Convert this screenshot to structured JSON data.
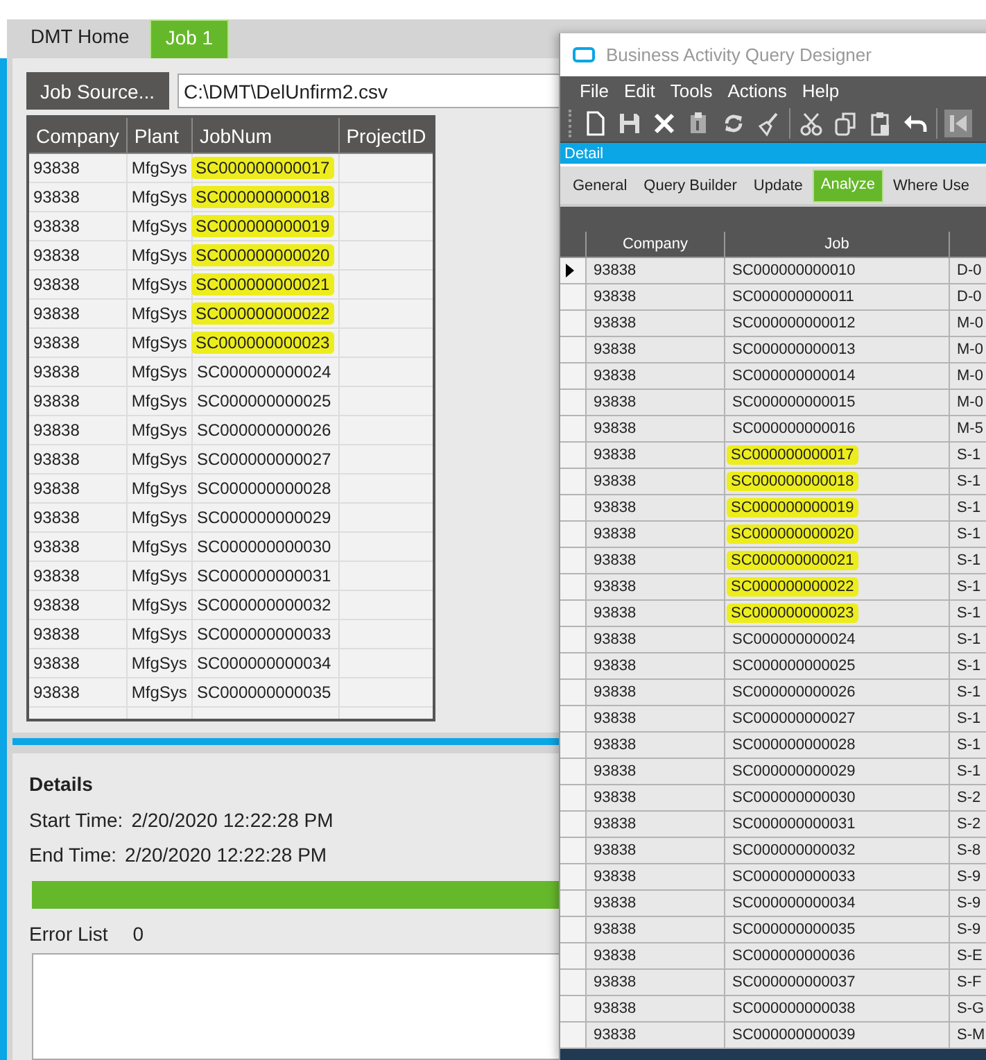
{
  "app": {
    "tabs": [
      {
        "label": "DMT Home",
        "selected": false
      },
      {
        "label": "Job 1",
        "selected": true
      }
    ],
    "job_source_button": "Job Source...",
    "job_source_path": "C:\\DMT\\DelUnfirm2.csv",
    "table": {
      "columns": [
        "Company",
        "Plant",
        "JobNum",
        "ProjectID"
      ],
      "rows": [
        {
          "company": "93838",
          "plant": "MfgSys",
          "jobnum": "SC000000000017",
          "highlighted": true
        },
        {
          "company": "93838",
          "plant": "MfgSys",
          "jobnum": "SC000000000018",
          "highlighted": true
        },
        {
          "company": "93838",
          "plant": "MfgSys",
          "jobnum": "SC000000000019",
          "highlighted": true
        },
        {
          "company": "93838",
          "plant": "MfgSys",
          "jobnum": "SC000000000020",
          "highlighted": true
        },
        {
          "company": "93838",
          "plant": "MfgSys",
          "jobnum": "SC000000000021",
          "highlighted": true
        },
        {
          "company": "93838",
          "plant": "MfgSys",
          "jobnum": "SC000000000022",
          "highlighted": true
        },
        {
          "company": "93838",
          "plant": "MfgSys",
          "jobnum": "SC000000000023",
          "highlighted": true
        },
        {
          "company": "93838",
          "plant": "MfgSys",
          "jobnum": "SC000000000024",
          "highlighted": false
        },
        {
          "company": "93838",
          "plant": "MfgSys",
          "jobnum": "SC000000000025",
          "highlighted": false
        },
        {
          "company": "93838",
          "plant": "MfgSys",
          "jobnum": "SC000000000026",
          "highlighted": false
        },
        {
          "company": "93838",
          "plant": "MfgSys",
          "jobnum": "SC000000000027",
          "highlighted": false
        },
        {
          "company": "93838",
          "plant": "MfgSys",
          "jobnum": "SC000000000028",
          "highlighted": false
        },
        {
          "company": "93838",
          "plant": "MfgSys",
          "jobnum": "SC000000000029",
          "highlighted": false
        },
        {
          "company": "93838",
          "plant": "MfgSys",
          "jobnum": "SC000000000030",
          "highlighted": false
        },
        {
          "company": "93838",
          "plant": "MfgSys",
          "jobnum": "SC000000000031",
          "highlighted": false
        },
        {
          "company": "93838",
          "plant": "MfgSys",
          "jobnum": "SC000000000032",
          "highlighted": false
        },
        {
          "company": "93838",
          "plant": "MfgSys",
          "jobnum": "SC000000000033",
          "highlighted": false
        },
        {
          "company": "93838",
          "plant": "MfgSys",
          "jobnum": "SC000000000034",
          "highlighted": false
        },
        {
          "company": "93838",
          "plant": "MfgSys",
          "jobnum": "SC000000000035",
          "highlighted": false
        }
      ]
    },
    "details": {
      "title": "Details",
      "start_time_label": "Start Time:",
      "start_time": "2/20/2020 12:22:28 PM",
      "end_time_label": "End Time:",
      "end_time": "2/20/2020 12:22:28 PM",
      "progress": {
        "level": 1
      },
      "error_list_label": "Error List",
      "error_count": "0"
    }
  },
  "query_designer": {
    "title": "Business Activity Query Designer",
    "menu": [
      "File",
      "Edit",
      "Tools",
      "Actions",
      "Help"
    ],
    "panel_title": "Detail",
    "tabs": [
      {
        "label": "General",
        "selected": false
      },
      {
        "label": "Query Builder",
        "selected": false
      },
      {
        "label": "Update",
        "selected": false
      },
      {
        "label": "Analyze",
        "selected": true
      },
      {
        "label": "Where Use",
        "selected": false
      }
    ],
    "grid": {
      "columns": [
        "Company",
        "Job"
      ],
      "rows": [
        {
          "company": "93838",
          "job": "SC000000000010",
          "column_3": "D-0",
          "current": true,
          "highlighted": false
        },
        {
          "company": "93838",
          "job": "SC000000000011",
          "column_3": "D-0",
          "current": false,
          "highlighted": false
        },
        {
          "company": "93838",
          "job": "SC000000000012",
          "column_3": "M-0",
          "current": false,
          "highlighted": false
        },
        {
          "company": "93838",
          "job": "SC000000000013",
          "column_3": "M-0",
          "current": false,
          "highlighted": false
        },
        {
          "company": "93838",
          "job": "SC000000000014",
          "column_3": "M-0",
          "current": false,
          "highlighted": false
        },
        {
          "company": "93838",
          "job": "SC000000000015",
          "column_3": "M-0",
          "current": false,
          "highlighted": false
        },
        {
          "company": "93838",
          "job": "SC000000000016",
          "column_3": "M-5",
          "current": false,
          "highlighted": false
        },
        {
          "company": "93838",
          "job": "SC000000000017",
          "column_3": "S-1",
          "current": false,
          "highlighted": true
        },
        {
          "company": "93838",
          "job": "SC000000000018",
          "column_3": "S-1",
          "current": false,
          "highlighted": true
        },
        {
          "company": "93838",
          "job": "SC000000000019",
          "column_3": "S-1",
          "current": false,
          "highlighted": true
        },
        {
          "company": "93838",
          "job": "SC000000000020",
          "column_3": "S-1",
          "current": false,
          "highlighted": true
        },
        {
          "company": "93838",
          "job": "SC000000000021",
          "column_3": "S-1",
          "current": false,
          "highlighted": true
        },
        {
          "company": "93838",
          "job": "SC000000000022",
          "column_3": "S-1",
          "current": false,
          "highlighted": true
        },
        {
          "company": "93838",
          "job": "SC000000000023",
          "column_3": "S-1",
          "current": false,
          "highlighted": true
        },
        {
          "company": "93838",
          "job": "SC000000000024",
          "column_3": "S-1",
          "current": false,
          "highlighted": false
        },
        {
          "company": "93838",
          "job": "SC000000000025",
          "column_3": "S-1",
          "current": false,
          "highlighted": false
        },
        {
          "company": "93838",
          "job": "SC000000000026",
          "column_3": "S-1",
          "current": false,
          "highlighted": false
        },
        {
          "company": "93838",
          "job": "SC000000000027",
          "column_3": "S-1",
          "current": false,
          "highlighted": false
        },
        {
          "company": "93838",
          "job": "SC000000000028",
          "column_3": "S-1",
          "current": false,
          "highlighted": false
        },
        {
          "company": "93838",
          "job": "SC000000000029",
          "column_3": "S-1",
          "current": false,
          "highlighted": false
        },
        {
          "company": "93838",
          "job": "SC000000000030",
          "column_3": "S-2",
          "current": false,
          "highlighted": false
        },
        {
          "company": "93838",
          "job": "SC000000000031",
          "column_3": "S-2",
          "current": false,
          "highlighted": false
        },
        {
          "company": "93838",
          "job": "SC000000000032",
          "column_3": "S-8",
          "current": false,
          "highlighted": false
        },
        {
          "company": "93838",
          "job": "SC000000000033",
          "column_3": "S-9",
          "current": false,
          "highlighted": false
        },
        {
          "company": "93838",
          "job": "SC000000000034",
          "column_3": "S-9",
          "current": false,
          "highlighted": false
        },
        {
          "company": "93838",
          "job": "SC000000000035",
          "column_3": "S-9",
          "current": false,
          "highlighted": false
        },
        {
          "company": "93838",
          "job": "SC000000000036",
          "column_3": "S-E",
          "current": false,
          "highlighted": false
        },
        {
          "company": "93838",
          "job": "SC000000000037",
          "column_3": "S-F",
          "current": false,
          "highlighted": false
        },
        {
          "company": "93838",
          "job": "SC000000000038",
          "column_3": "S-G",
          "current": false,
          "highlighted": false
        },
        {
          "company": "93838",
          "job": "SC000000000039",
          "column_3": "S-M",
          "current": false,
          "highlighted": false
        }
      ]
    }
  }
}
